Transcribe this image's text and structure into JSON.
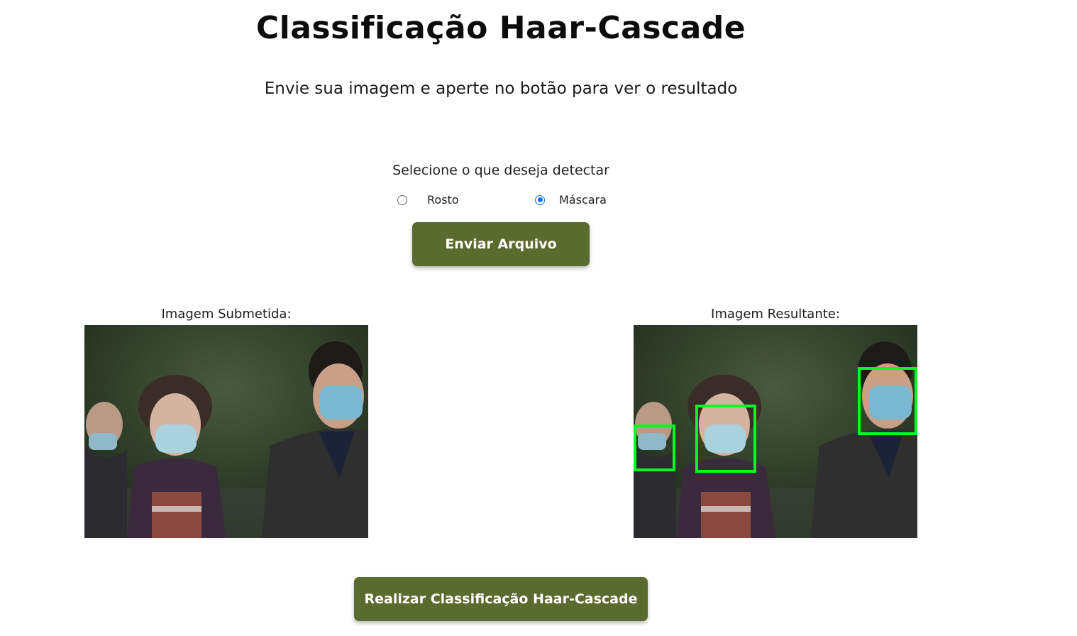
{
  "header": {
    "title": "Classificação Haar-Cascade",
    "subtitle": "Envie sua imagem e aperte no botão para ver o resultado"
  },
  "detection": {
    "prompt": "Selecione o que deseja detectar",
    "options": [
      {
        "label": "Rosto",
        "selected": false
      },
      {
        "label": "Máscara",
        "selected": true
      }
    ]
  },
  "upload_button": {
    "label": "Enviar Arquivo"
  },
  "submitted_image": {
    "label": "Imagem Submetida:"
  },
  "result_image": {
    "label": "Imagem Resultante:",
    "detections": 3,
    "box_color": "#00ff1e"
  },
  "classify_button": {
    "label": "Realizar Classificação Haar-Cascade"
  },
  "colors": {
    "button_bg": "#5a6b2f",
    "button_text": "#ffffff",
    "radio_selected": "#1a6fd1"
  }
}
